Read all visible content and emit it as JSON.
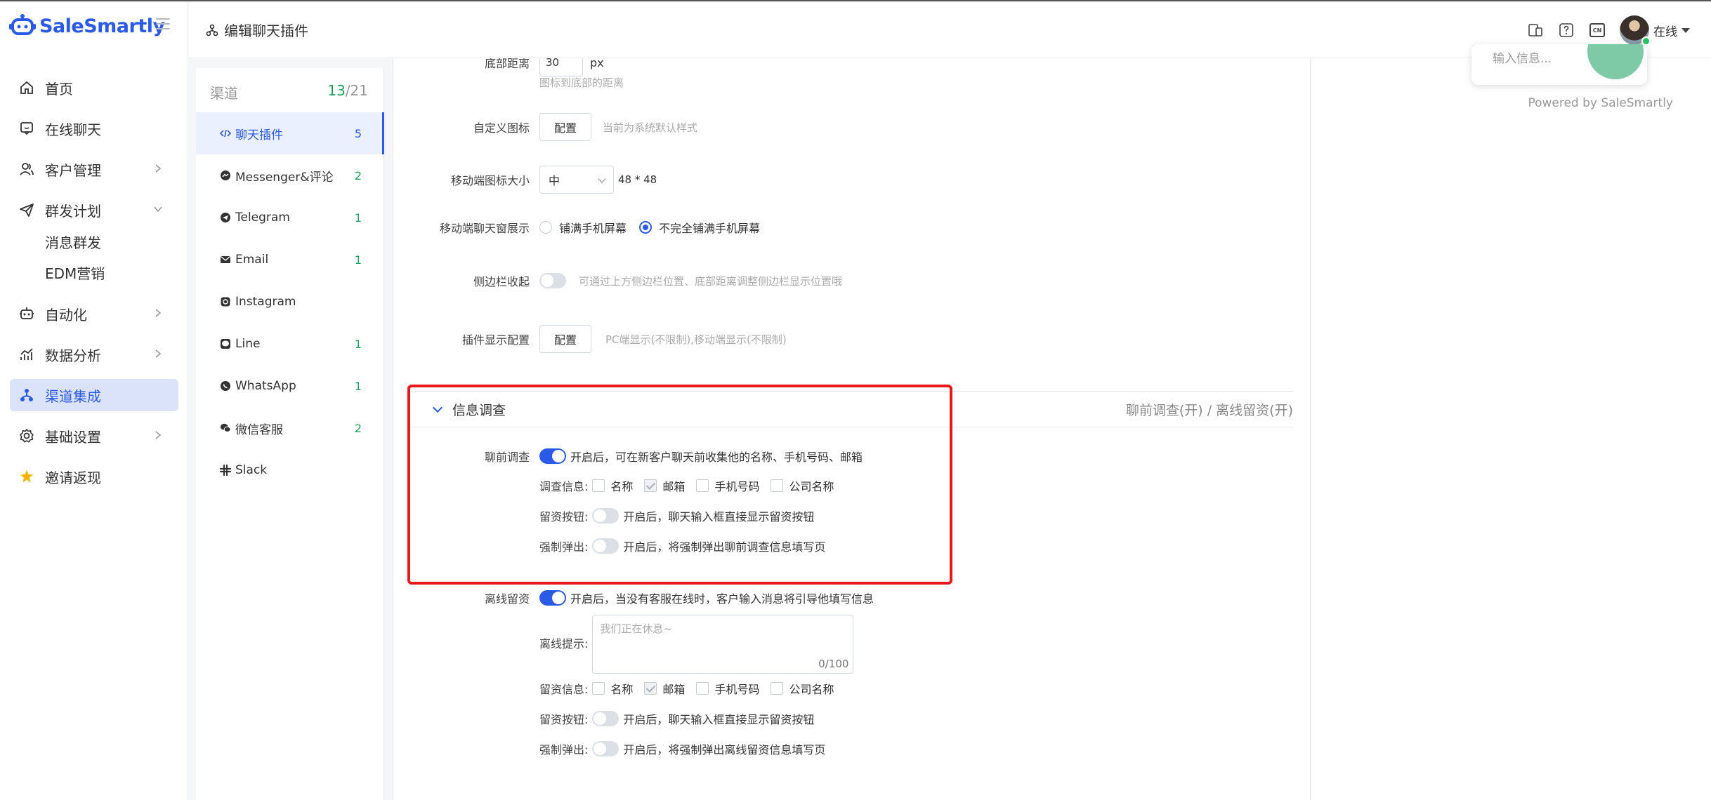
{
  "brand": {
    "name": "SaleSmartly",
    "color": "#2b59e8"
  },
  "nav": {
    "items": [
      {
        "label": "首页",
        "icon": "home-icon"
      },
      {
        "label": "在线聊天",
        "icon": "chat-icon"
      },
      {
        "label": "客户管理",
        "icon": "users-icon"
      },
      {
        "label": "群发计划",
        "icon": "send-icon"
      },
      {
        "label": "自动化",
        "icon": "robot-icon"
      },
      {
        "label": "数据分析",
        "icon": "chart-icon"
      },
      {
        "label": "渠道集成",
        "icon": "network-icon"
      },
      {
        "label": "基础设置",
        "icon": "gear-icon"
      },
      {
        "label": "邀请返现",
        "icon": "star-icon"
      }
    ],
    "sub": [
      "消息群发",
      "EDM营销"
    ]
  },
  "breadcrumb": {
    "title": "编辑聊天插件"
  },
  "user": {
    "status": "在线",
    "status_color": "#22c55e"
  },
  "channels": {
    "header": "渠道",
    "active_count": "13",
    "total": "/21",
    "items": [
      {
        "label": "聊天插件",
        "count": "5"
      },
      {
        "label": "Messenger&评论",
        "count": "2"
      },
      {
        "label": "Telegram",
        "count": "1"
      },
      {
        "label": "Email",
        "count": "1"
      },
      {
        "label": "Instagram",
        "count": ""
      },
      {
        "label": "Line",
        "count": "1"
      },
      {
        "label": "WhatsApp",
        "count": "1"
      },
      {
        "label": "微信客服",
        "count": "2"
      },
      {
        "label": "Slack",
        "count": ""
      }
    ]
  },
  "settings": {
    "bottom_distance": {
      "label": "底部距离",
      "value": "30",
      "unit": "px",
      "hint": "图标到底部的距离"
    },
    "custom_icon": {
      "label": "自定义图标",
      "button": "配置",
      "hint": "当前为系统默认样式"
    },
    "mobile_icon_size": {
      "label": "移动端图标大小",
      "value": "中",
      "dims": "48 * 48"
    },
    "mobile_window": {
      "label": "移动端聊天窗展示",
      "option1": "铺满手机屏幕",
      "option2": "不完全铺满手机屏幕",
      "selected": "option2"
    },
    "sidebar_collapse": {
      "label": "侧边栏收起",
      "hint": "可通过上方侧边栏位置、底部距离调整侧边栏显示位置哦",
      "enabled": false
    },
    "display_config": {
      "label": "插件显示配置",
      "button": "配置",
      "hint": "PC端显示(不限制),移动端显示(不限制)"
    }
  },
  "survey": {
    "title": "信息调查",
    "summary": "聊前调查(开) / 离线留资(开)",
    "pre_chat": {
      "label": "聊前调查",
      "desc": "开启后，可在新客户聊天前收集他的名称、手机号码、邮箱",
      "enabled": true,
      "fields_label": "调查信息:",
      "fields": [
        {
          "label": "名称",
          "checked": false
        },
        {
          "label": "邮箱",
          "checked": true
        },
        {
          "label": "手机号码",
          "checked": false
        },
        {
          "label": "公司名称",
          "checked": false
        }
      ],
      "button_label": "留资按钮:",
      "button_desc": "开启后，聊天输入框直接显示留资按钮",
      "popup_label": "强制弹出:",
      "popup_desc": "开启后，将强制弹出聊前调查信息填写页"
    },
    "offline": {
      "label": "离线留资",
      "desc": "开启后，当没有客服在线时，客户输入消息将引导他填写信息",
      "enabled": true,
      "tip_label": "离线提示:",
      "tip_placeholder": "我们正在休息~",
      "tip_count": "0/100",
      "fields_label": "留资信息:",
      "fields": [
        {
          "label": "名称",
          "checked": false
        },
        {
          "label": "邮箱",
          "checked": true
        },
        {
          "label": "手机号码",
          "checked": false
        },
        {
          "label": "公司名称",
          "checked": false
        }
      ],
      "button_label": "留资按钮:",
      "button_desc": "开启后，聊天输入框直接显示留资按钮",
      "popup_label": "强制弹出:",
      "popup_desc": "开启后，将强制弹出离线留资信息填写页"
    }
  },
  "preview": {
    "hint": "输入信息...",
    "powered": "Powered by SaleSmartly"
  },
  "colors": {
    "accent": "#2b59e8",
    "highlight": "#e8191c",
    "count_green": "#1aa35a"
  }
}
